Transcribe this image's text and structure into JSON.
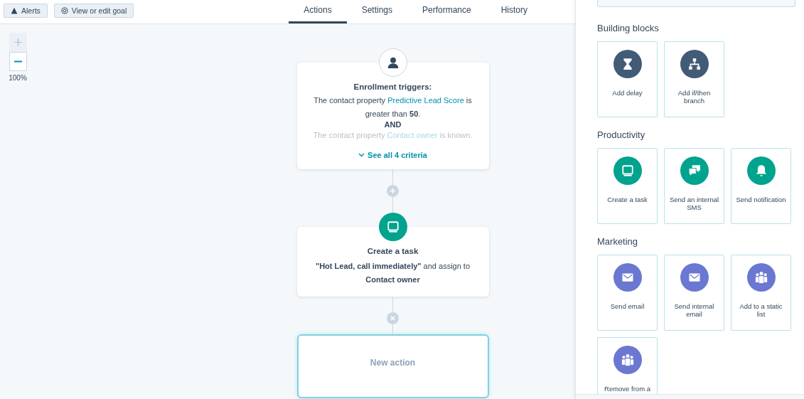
{
  "toolbar": {
    "buttons": [
      {
        "label": "Alerts",
        "kind": "warning"
      },
      {
        "label": "View or edit goal",
        "kind": "target"
      }
    ]
  },
  "tabs": [
    {
      "label": "Actions",
      "selected": true
    },
    {
      "label": "Settings",
      "selected": false
    },
    {
      "label": "Performance",
      "selected": false
    },
    {
      "label": "History",
      "selected": false
    }
  ],
  "zoom": {
    "zoom_in": {
      "disabled": true
    },
    "zoom_out": {
      "disabled": false
    },
    "level": "100%"
  },
  "workflow": {
    "trigger": {
      "title": "Enrollment triggers:",
      "criteria": [
        {
          "faded": false,
          "parts": [
            {
              "kind": "plain",
              "text": "The contact property "
            },
            {
              "kind": "link",
              "text": "Predictive Lead Score"
            },
            {
              "kind": "plain",
              "text": " is greater than "
            },
            {
              "kind": "strong",
              "text": "50"
            },
            {
              "kind": "plain",
              "text": "."
            }
          ]
        },
        {
          "faded": true,
          "parts": [
            {
              "kind": "plain",
              "text": "The contact property "
            },
            {
              "kind": "link",
              "text": "Contact owner"
            },
            {
              "kind": "plain",
              "text": " is known."
            }
          ]
        }
      ],
      "joiner": "AND",
      "see_all": "See all 4 criteria"
    },
    "steps": [
      {
        "kind": "add"
      },
      {
        "kind": "action",
        "title": "Create a task",
        "description": "**\"Hot Lead, call immediately\"** and assign to **Contact owner**"
      },
      {
        "kind": "remove"
      },
      {
        "kind": "new",
        "title": "New action"
      }
    ]
  },
  "panel": {
    "sections": [
      {
        "title": "Building blocks",
        "color": "#425b76",
        "actions": [
          {
            "label": "Add delay",
            "kind": "delay"
          },
          {
            "label": "Add if/then branch",
            "kind": "branch"
          }
        ]
      },
      {
        "title": "Productivity",
        "color": "#00a38d",
        "actions": [
          {
            "label": "Create a task",
            "kind": "task"
          },
          {
            "label": "Send an internal SMS",
            "kind": "sms"
          },
          {
            "label": "Send notification",
            "kind": "notification"
          }
        ]
      },
      {
        "title": "Marketing",
        "color": "#6a78d1",
        "actions": [
          {
            "label": "Send email",
            "kind": "email"
          },
          {
            "label": "Send internal email",
            "kind": "email"
          },
          {
            "label": "Add to a static list",
            "kind": "list"
          },
          {
            "label": "Remove from a",
            "kind": "list"
          }
        ]
      }
    ]
  }
}
